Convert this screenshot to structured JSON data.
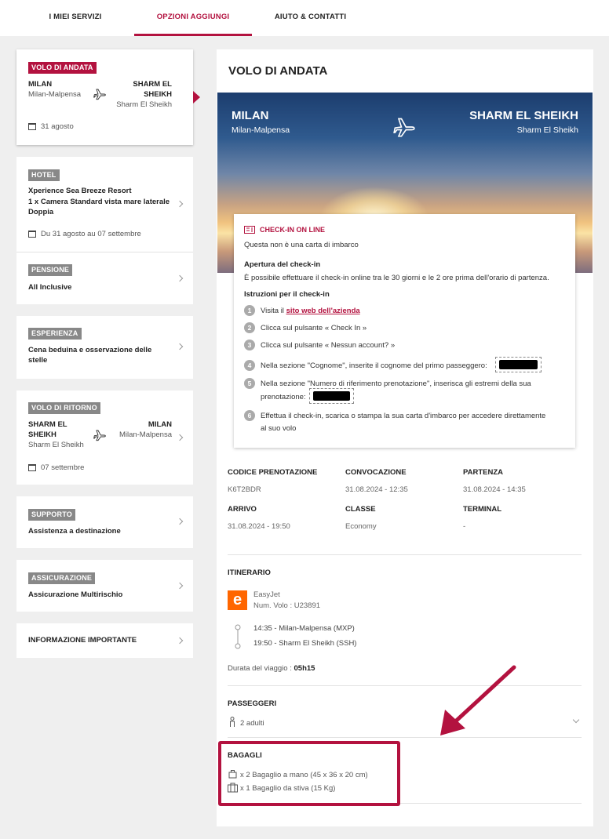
{
  "nav": {
    "tabs": [
      "I MIEI SERVIZI",
      "OPZIONI AGGIUNGI",
      "AIUTO & CONTATTI"
    ]
  },
  "sidebar": {
    "outbound": {
      "badge": "VOLO DI ANDATA",
      "from_city": "MILAN",
      "from_airport": "Milan-Malpensa",
      "to_city_1": "SHARM EL",
      "to_city_2": "SHEIKH",
      "to_airport": "Sharm El Sheikh",
      "date": "31 agosto"
    },
    "hotel": {
      "badge": "HOTEL",
      "name": "Xperience Sea Breeze Resort",
      "room_1": "1 x Camera Standard vista mare laterale",
      "room_2": "Doppia",
      "dates": "Du 31 agosto au 07 settembre"
    },
    "board": {
      "badge": "PENSIONE",
      "value": "All Inclusive"
    },
    "experience": {
      "badge": "ESPERIENZA",
      "line1": "Cena beduina e osservazione delle",
      "line2": "stelle"
    },
    "return": {
      "badge": "VOLO DI RITORNO",
      "from_city_1": "SHARM EL",
      "from_city_2": "SHEIKH",
      "from_airport": "Sharm El Sheikh",
      "to_city": "MILAN",
      "to_airport": "Milan-Malpensa",
      "date": "07 settembre"
    },
    "support": {
      "badge": "SUPPORTO",
      "value": "Assistenza a destinazione"
    },
    "insurance": {
      "badge": "ASSICURAZIONE",
      "value": "Assicurazione Multirischio"
    },
    "important": "INFORMAZIONE IMPORTANTE"
  },
  "main": {
    "title": "VOLO DI ANDATA",
    "hero": {
      "from_city": "MILAN",
      "from_airport": "Milan-Malpensa",
      "to_city": "SHARM EL SHEIKH",
      "to_airport": "Sharm El Sheikh"
    },
    "checkin": {
      "title": "CHECK-IN ON LINE",
      "subtitle": "Questa non è una carta di imbarco",
      "opening_title": "Apertura del check-in",
      "opening_text": "È possibile effettuare il check-in online tra le 30 giorni e le 2 ore prima dell'orario di partenza.",
      "instructions_title": "Istruzioni per il check-in",
      "step1_prefix": "Visita il ",
      "step1_link": "sito web dell'azienda",
      "step2": "Clicca sul pulsante « Check In »",
      "step3": "Clicca sul pulsante « Nessun account? »",
      "step4": "Nella sezione \"Cognome\", inserite il cognome del primo passeggero:",
      "step5_line1": "Nella sezione \"Numero di riferimento prenotazione\", inserisca gli estremi della sua",
      "step5_line2": "prenotazione:",
      "step6_line1": "Effettua il check-in, scarica o stampa la sua carta d'imbarco per accedere direttamente",
      "step6_line2": "al suo volo",
      "step_numbers": [
        "1",
        "2",
        "3",
        "4",
        "5",
        "6"
      ]
    },
    "details": {
      "booking_code_label": "CODICE PRENOTAZIONE",
      "booking_code": "K6T2BDR",
      "call_label": "CONVOCAZIONE",
      "call": "31.08.2024 - 12:35",
      "departure_label": "PARTENZA",
      "departure": "31.08.2024 - 14:35",
      "arrival_label": "ARRIVO",
      "arrival": "31.08.2024 - 19:50",
      "class_label": "CLASSE",
      "class": "Economy",
      "terminal_label": "TERMINAL",
      "terminal": "-"
    },
    "itinerary": {
      "title": "ITINERARIO",
      "airline": "EasyJet",
      "flight_no": "Num. Volo : U23891",
      "dep": "14:35 - Milan-Malpensa (MXP)",
      "arr": "19:50 - Sharm El Sheikh (SSH)",
      "duration_label": "Durata del viaggio : ",
      "duration": "05h15"
    },
    "passengers": {
      "title": "PASSEGGERI",
      "value": "2 adulti"
    },
    "baggage": {
      "title": "BAGAGLI",
      "hand": "x 2 Bagaglio a mano (45 x 36 x 20 cm)",
      "hold": "x 1 Bagaglio da stiva (15 Kg)"
    }
  },
  "colors": {
    "accent": "#b3123f",
    "easyjet": "#ff6600"
  }
}
